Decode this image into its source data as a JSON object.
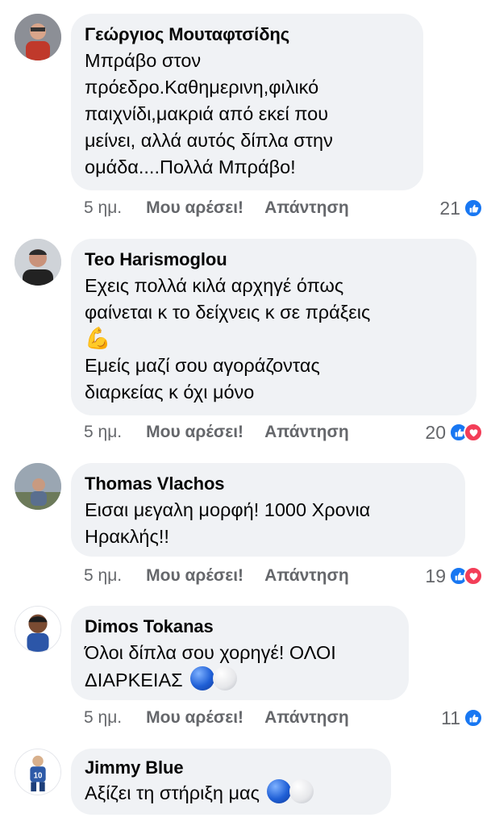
{
  "comments": [
    {
      "author": "Γεώργιος Μουταφτσίδης",
      "text": "Μπράβο στον\nπρόεδρο.Καθημερινη,φιλικό\nπαιχνίδι,μακριά από εκεί που\nμείνει, αλλά αυτός δίπλα στην\nομάδα....Πολλά Μπράβο!",
      "time": "5 ημ.",
      "like_label": "Μου αρέσει!",
      "reply_label": "Απάντηση",
      "reaction_count": "21",
      "reactions": [
        "like"
      ]
    },
    {
      "author": "Teo Harismoglou",
      "text_line1": "Εχεις πολλά κιλά αρχηγέ όπως\nφαίνεται κ το δείχνεις κ σε πράξεις",
      "emoji": "💪",
      "text_line2": "Εμείς μαζί σου αγοράζοντας\nδιαρκείας κ όχι μόνο",
      "time": "5 ημ.",
      "like_label": "Μου αρέσει!",
      "reply_label": "Απάντηση",
      "reaction_count": "20",
      "reactions": [
        "like",
        "love"
      ]
    },
    {
      "author": "Thomas Vlachos",
      "text": "Εισαι μεγαλη μορφή! 1000 Χρονια\nΗρακλής!!",
      "time": "5 ημ.",
      "like_label": "Μου αρέσει!",
      "reply_label": "Απάντηση",
      "reaction_count": "19",
      "reactions": [
        "like",
        "love"
      ]
    },
    {
      "author": "Dimos Tokanas",
      "text_line1": "Όλοι δίπλα σου χορηγέ! ΟΛΟΙ",
      "text_line2": "ΔΙΑΡΚΕΙΑΣ",
      "time": "5 ημ.",
      "like_label": "Μου αρέσει!",
      "reply_label": "Απάντηση",
      "reaction_count": "11",
      "reactions": [
        "like"
      ]
    },
    {
      "author": "Jimmy Blue",
      "text": "Αξίζει τη στήριξη μας",
      "avatar_jersey_number": "10"
    }
  ],
  "colors": {
    "bubble": "#f0f2f5",
    "meta_text": "#65676b",
    "like_blue": "#1877f2",
    "love_red": "#f33e58"
  },
  "icons": {
    "like_reaction": "thumbs-up-icon",
    "love_reaction": "heart-icon",
    "team_emoji": "blue-white-circles"
  }
}
